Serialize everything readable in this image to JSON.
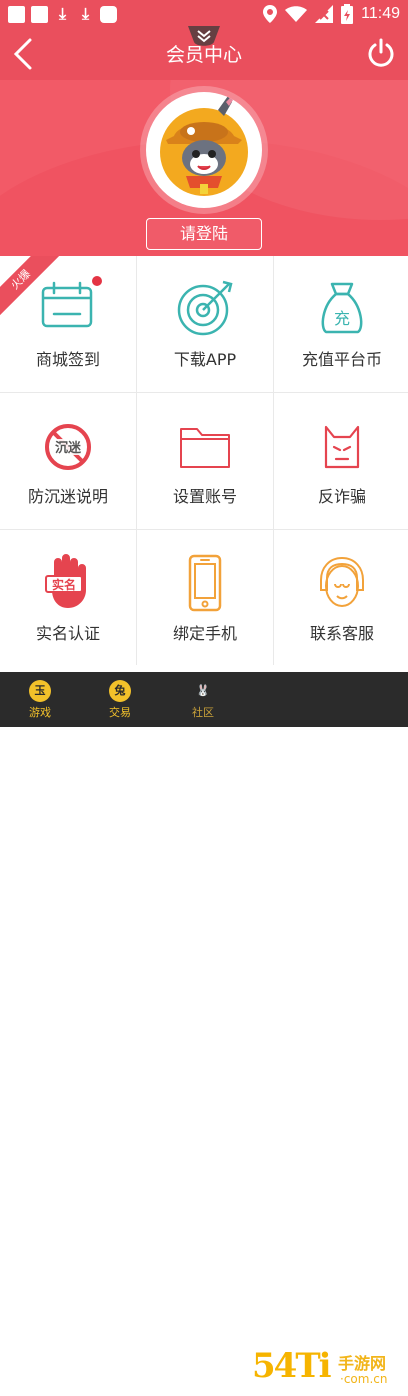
{
  "status_bar": {
    "time": "11:49"
  },
  "header": {
    "title": "会员中心"
  },
  "profile": {
    "login_label": "请登陆"
  },
  "badge": {
    "text": "火爆"
  },
  "grid": [
    {
      "label": "商城签到",
      "icon": "calendar-icon"
    },
    {
      "label": "下载APP",
      "icon": "target-icon"
    },
    {
      "label": "充值平台币",
      "icon": "money-bag-icon"
    },
    {
      "label": "防沉迷说明",
      "icon": "anti-addiction-icon"
    },
    {
      "label": "设置账号",
      "icon": "folder-icon"
    },
    {
      "label": "反诈骗",
      "icon": "devil-icon"
    },
    {
      "label": "实名认证",
      "icon": "hand-id-icon"
    },
    {
      "label": "绑定手机",
      "icon": "phone-icon"
    },
    {
      "label": "联系客服",
      "icon": "customer-service-icon"
    }
  ],
  "anti_addiction_text": "沉迷",
  "realname_badge": "实名",
  "bag_char": "充",
  "tabbar": [
    {
      "label": "游戏",
      "glyph": "玉"
    },
    {
      "label": "交易",
      "glyph": "兔"
    },
    {
      "label": "社区",
      "glyph": "🐰"
    }
  ],
  "watermark": {
    "big": "54Ti",
    "title": "手游网",
    "url": "·com.cn"
  },
  "colors": {
    "primary": "#ea4f5d",
    "teal": "#3bb4b0",
    "tab_gold": "#f2c12a"
  }
}
